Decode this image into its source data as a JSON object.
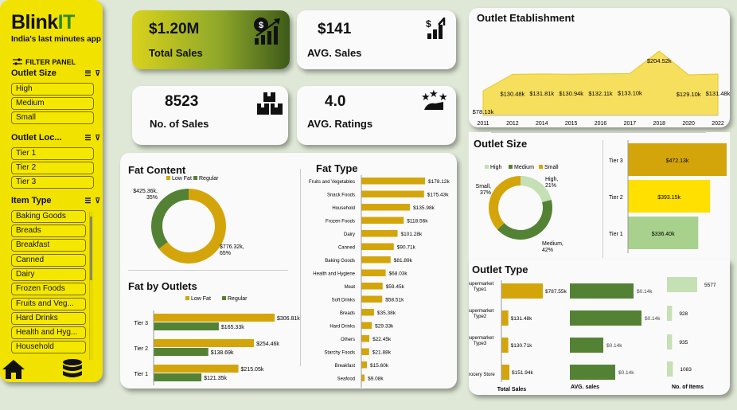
{
  "brand": {
    "name_main": "Blink",
    "name_accent": "IT",
    "tagline": "India's last minutes app"
  },
  "filter_panel": {
    "title": "FILTER PANEL",
    "outlet_size": {
      "title": "Outlet Size",
      "items": [
        "High",
        "Medium",
        "Small"
      ]
    },
    "outlet_location": {
      "title": "Outlet Loc...",
      "items": [
        "Tier 1",
        "Tier 2",
        "Tier 3"
      ]
    },
    "item_type": {
      "title": "Item Type",
      "items": [
        "Baking Goods",
        "Breads",
        "Breakfast",
        "Canned",
        "Dairy",
        "Frozen Foods",
        "Fruits and Veg...",
        "Hard Drinks",
        "Health and Hyg...",
        "Household"
      ]
    }
  },
  "nav": {
    "home_icon": "home-icon",
    "data_icon": "database-icon"
  },
  "kpis": {
    "total_sales": {
      "value": "$1.20M",
      "label": "Total Sales",
      "icon": "sales-growth-icon"
    },
    "avg_sales": {
      "value": "$141",
      "label": "AVG. Sales",
      "icon": "dollar-up-icon"
    },
    "no_sales": {
      "value": "8523",
      "label": "No. of Sales",
      "icon": "boxes-icon"
    },
    "avg_ratings": {
      "value": "4.0",
      "label": "AVG. Ratings",
      "icon": "stars-icon"
    }
  },
  "titles": {
    "establishment": "Outlet Etablishment",
    "fat_content": "Fat Content",
    "fat_type": "Fat Type",
    "fat_outlets": "Fat by Outlets",
    "outlet_size": "Outlet Size",
    "outlet_type": "Outlet Type"
  },
  "colors": {
    "gold": "#d4a50a",
    "green": "#548235",
    "yellow": "#ffe000",
    "light_green": "#a9d18e",
    "pale_green": "#c5e0b4",
    "sidebar": "#f2e200"
  },
  "chart_data": [
    {
      "id": "establishment",
      "type": "area",
      "x": [
        "2011",
        "2012",
        "2014",
        "2015",
        "2016",
        "2017",
        "2018",
        "2020",
        "2022"
      ],
      "values": [
        78.13,
        130.48,
        131.81,
        130.94,
        132.11,
        133.1,
        204.52,
        129.1,
        131.48
      ],
      "labels": [
        "$78.13k",
        "$130.48k",
        "$131.81k",
        "$130.94k",
        "$132.11k",
        "$133.10k",
        "$204.52k",
        "$129.10k",
        "$131.48k"
      ]
    },
    {
      "id": "fat_content",
      "type": "pie",
      "legend": [
        "Low Fat",
        "Regular"
      ],
      "values": [
        776.32,
        425.36
      ],
      "labels": [
        "$776.32k,\n65%",
        "$425.36k,\n35%"
      ]
    },
    {
      "id": "fat_type",
      "type": "bar",
      "categories": [
        "Fruits and Vegetables",
        "Snack Foods",
        "Household",
        "Frozen Foods",
        "Dairy",
        "Canned",
        "Baking Goods",
        "Health and Hygiene",
        "Meat",
        "Soft Drinks",
        "Breads",
        "Hard Drinks",
        "Others",
        "Starchy Foods",
        "Breakfast",
        "Seafood"
      ],
      "values": [
        178.12,
        175.43,
        135.98,
        118.56,
        101.28,
        90.71,
        81.89,
        68.03,
        59.45,
        58.51,
        35.38,
        29.33,
        22.45,
        21.88,
        15.6,
        9.08
      ],
      "labels": [
        "$178.12k",
        "$175.43k",
        "$135.98k",
        "$118.56k",
        "$101.28k",
        "$90.71k",
        "$81.89k",
        "$68.03k",
        "$59.45k",
        "$58.51k",
        "$35.38k",
        "$29.33k",
        "$22.45k",
        "$21.88k",
        "$15.60k",
        "$9.08k"
      ]
    },
    {
      "id": "fat_outlets",
      "type": "bar",
      "categories": [
        "Tier 3",
        "Tier 2",
        "Tier 1"
      ],
      "series": [
        {
          "name": "Low Fat",
          "values": [
            306.81,
            254.46,
            215.05
          ],
          "labels": [
            "$306.81k",
            "$254.46k",
            "$215.05k"
          ]
        },
        {
          "name": "Regular",
          "values": [
            165.33,
            138.69,
            121.35
          ],
          "labels": [
            "$165.33k",
            "$138.69k",
            "$121.35k"
          ]
        }
      ]
    },
    {
      "id": "outlet_size",
      "type": "pie",
      "legend": [
        "High",
        "Medium",
        "Small"
      ],
      "values": [
        21,
        42,
        37
      ],
      "labels": [
        "High,\n21%",
        "Medium,\n42%",
        "Small,\n37%"
      ]
    },
    {
      "id": "outlet_location",
      "type": "bar",
      "categories": [
        "Tier 3",
        "Tier 2",
        "Tier 1"
      ],
      "values": [
        472.13,
        393.15,
        336.4
      ],
      "labels": [
        "$472.13k",
        "$393.15k",
        "$336.40k"
      ]
    },
    {
      "id": "outlet_type",
      "type": "table",
      "rows": [
        "Supermarket\nType1",
        "Supermarket\nType2",
        "Supermarket\nType3",
        "Grocery Store"
      ],
      "columns": [
        "Total Sales",
        "AVG. sales",
        "No. of Items"
      ],
      "total_sales": [
        787.55,
        131.48,
        130.71,
        151.94
      ],
      "total_sales_labels": [
        "$787.55k",
        "$131.48k",
        "$130.71k",
        "$151.94k"
      ],
      "avg_sales": [
        0.14,
        0.14,
        0.14,
        0.14
      ],
      "avg_sales_labels": [
        "$0.14k",
        "$0.14k",
        "$0.14k",
        "$0.14k"
      ],
      "items": [
        5577,
        928,
        935,
        1083
      ],
      "items_labels": [
        "5577",
        "928",
        "935",
        "1083"
      ]
    }
  ]
}
